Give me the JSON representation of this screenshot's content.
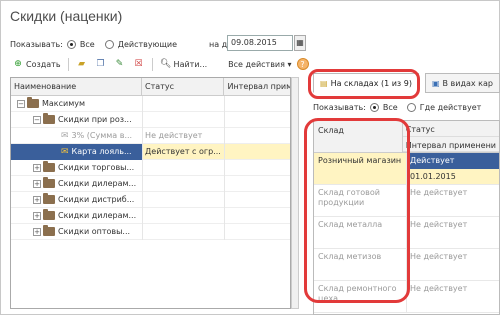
{
  "window": {
    "title": "Скидки (наценки)"
  },
  "filter": {
    "show_label": "Показывать:",
    "all_label": "Все",
    "active_label": "Действующие",
    "date_label": "на дату:",
    "date_value": "09.08.2015"
  },
  "toolbar": {
    "create_label": "Создать",
    "find_label": "Найти...",
    "all_actions_label": "Все действия ▾",
    "help_label": "?"
  },
  "tree": {
    "headers": [
      "Наименование",
      "Статус",
      "Интервал приме"
    ],
    "rows": [
      {
        "name": "Максимум",
        "status": "",
        "grey": false
      },
      {
        "name": "Скидки при роз...",
        "status": "",
        "grey": false
      },
      {
        "name": "3% (Сумма в...",
        "status": "Не действует",
        "grey": true
      },
      {
        "name": "Карта лояль...",
        "status": "Действует с огр...",
        "grey": false
      },
      {
        "name": "Скидки торговы...",
        "status": "",
        "grey": false
      },
      {
        "name": "Скидки дилерам...",
        "status": "",
        "grey": false
      },
      {
        "name": "Скидки дистриб...",
        "status": "",
        "grey": false
      },
      {
        "name": "Скидки дилерам...",
        "status": "",
        "grey": false
      },
      {
        "name": "Скидки оптовы...",
        "status": "",
        "grey": false
      }
    ]
  },
  "tabs": [
    {
      "label": "На складах (1 из 9)"
    },
    {
      "label": "В видах кар"
    }
  ],
  "right_filter": {
    "show_label": "Показывать:",
    "all_label": "Все",
    "active_label": "Где действует"
  },
  "grid": {
    "headers": {
      "warehouse": "Склад",
      "status": "Статус",
      "interval": "Интервал применени"
    },
    "rows": [
      {
        "warehouse": "Розничный магазин",
        "status": "Действует",
        "interval": "01.01.2015"
      },
      {
        "warehouse": "Склад готовой продукции",
        "status": "Не действует",
        "interval": ""
      },
      {
        "warehouse": "Склад металла",
        "status": "Не действует",
        "interval": ""
      },
      {
        "warehouse": "Склад метизов",
        "status": "Не действует",
        "interval": ""
      },
      {
        "warehouse": "Склад ремонтного цеха",
        "status": "Не действует",
        "interval": ""
      }
    ]
  },
  "colors": {
    "highlight": "#e23a3a",
    "selection": "#fff4c2",
    "active_cell": "#3a5f9b"
  }
}
